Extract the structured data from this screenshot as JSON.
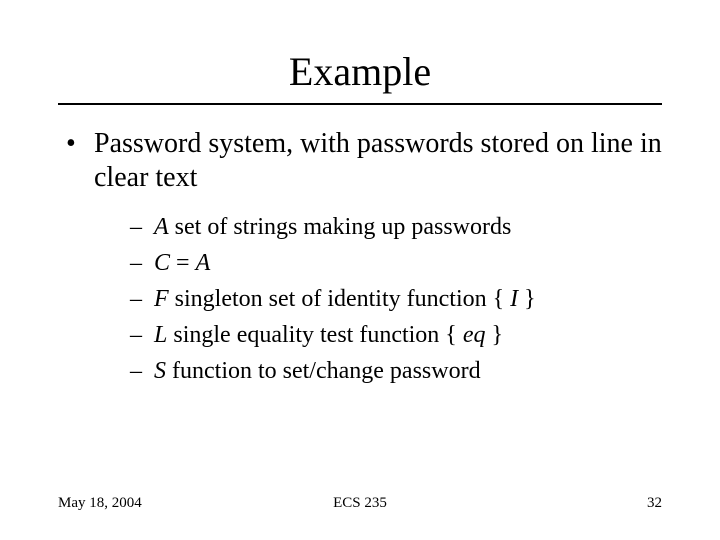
{
  "title": "Example",
  "bullet": {
    "text": "Password system, with passwords stored on line in clear text",
    "subs": [
      {
        "var": "A",
        "rest": " set of strings making up passwords"
      },
      {
        "var": "C",
        "rest": " = ",
        "var2": "A"
      },
      {
        "var": "F",
        "rest": " singleton set of identity function { ",
        "var2": "I",
        "rest2": " }"
      },
      {
        "var": "L",
        "rest": " single equality test function { ",
        "var2": "eq",
        "rest2": " }"
      },
      {
        "var": "S",
        "rest": " function to set/change password"
      }
    ]
  },
  "footer": {
    "date": "May 18, 2004",
    "course": "ECS 235",
    "page": "32"
  }
}
